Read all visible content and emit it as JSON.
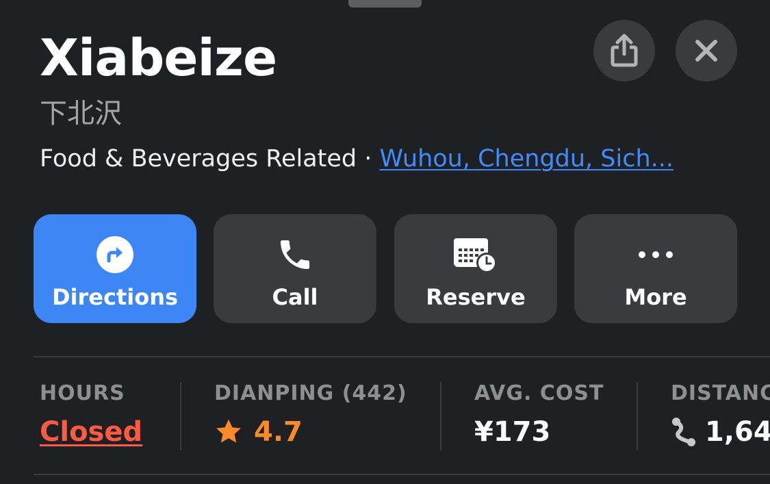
{
  "place": {
    "name": "Xiabeize",
    "native_name": "下北沢",
    "category": "Food & Beverages Related",
    "separator": " · ",
    "location": "Wuhou, Chengdu, Sich..."
  },
  "actions": [
    {
      "label": "Directions",
      "icon": "directions-icon"
    },
    {
      "label": "Call",
      "icon": "phone-icon"
    },
    {
      "label": "Reserve",
      "icon": "calendar-clock-icon"
    },
    {
      "label": "More",
      "icon": "more-icon"
    }
  ],
  "stats": {
    "hours": {
      "header": "HOURS",
      "value": "Closed"
    },
    "rating": {
      "header": "DIANPING (442)",
      "value": "4.7"
    },
    "cost": {
      "header": "AVG. COST",
      "value": "¥173"
    },
    "distance": {
      "header": "DISTANC",
      "value": "1,64"
    }
  },
  "colors": {
    "background": "#1f2023",
    "accent": "#3d86f6",
    "link": "#3f8cff",
    "closed": "#ff5a43",
    "rating": "#ff8a2a",
    "button": "#3a3b3e"
  }
}
